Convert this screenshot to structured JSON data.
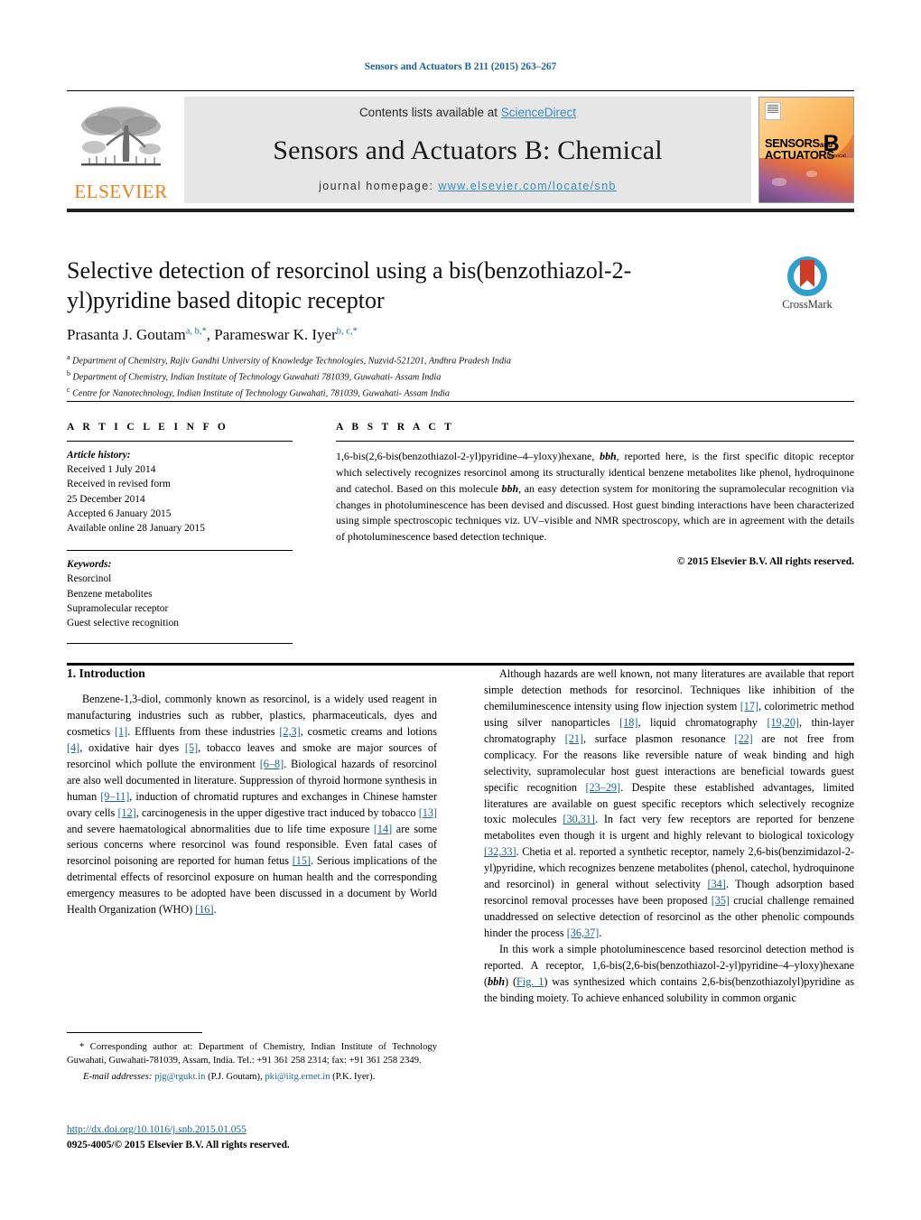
{
  "running_head": "Sensors and Actuators B 211 (2015) 263–267",
  "masthead": {
    "contents_prefix": "Contents lists available at ",
    "sciencedirect": "ScienceDirect",
    "journal_title": "Sensors and Actuators B: Chemical",
    "homepage_prefix": "journal homepage:",
    "homepage_url": "www.elsevier.com/locate/snb",
    "publisher_logo_text": "ELSEVIER",
    "cover": {
      "line1": "SENSORS",
      "line1_small": "and",
      "line2": "ACTUATORS",
      "volume_letter": "B",
      "volume_sub": "Chemical"
    }
  },
  "crossmark": {
    "label": "CrossMark"
  },
  "article": {
    "title": "Selective detection of resorcinol using a bis(benzothiazol-2-yl)pyridine based ditopic receptor",
    "authors": [
      {
        "name": "Prasanta J. Goutam",
        "sup": "a, b,",
        "star": "*"
      },
      {
        "name": "Parameswar K. Iyer",
        "sup": "b, c,",
        "star": "*"
      }
    ],
    "authors_separator": ", ",
    "affiliations": [
      {
        "marker": "a",
        "text": "Department of Chemistry, Rajiv Gandhi University of Knowledge Technologies, Nuzvid-521201, Andhra Pradesh India"
      },
      {
        "marker": "b",
        "text": "Department of Chemistry, Indian Institute of Technology Guwahati 781039, Guwahati- Assam India"
      },
      {
        "marker": "c",
        "text": "Centre for Nanotechnology, Indian Institute of Technology Guwahati, 781039, Guwahati- Assam India"
      }
    ]
  },
  "article_info": {
    "heading": "A R T I C L E   I N F O",
    "history_label": "Article history:",
    "history": [
      "Received 1 July 2014",
      "Received in revised form",
      "25 December 2014",
      "Accepted 6 January 2015",
      "Available online 28 January 2015"
    ],
    "keywords_label": "Keywords:",
    "keywords": [
      "Resorcinol",
      "Benzene metabolites",
      "Supramolecular receptor",
      "Guest selective recognition"
    ]
  },
  "abstract": {
    "heading": "A B S T R A C T",
    "part1": "1,6-bis(2,6-bis(benzothiazol-2-yl)pyridine–4–yloxy)hexane, ",
    "bbh1": "bbh",
    "part2": ", reported here, is the first specific ditopic receptor which selectively recognizes resorcinol among its structurally identical benzene metabolites like phenol, hydroquinone and catechol. Based on this molecule ",
    "bbh2": "bbh",
    "part3": ", an easy detection system for monitoring the supramolecular recognition via changes in photoluminescence has been devised and discussed. Host guest binding interactions have been characterized using simple spectroscopic techniques viz. UV–visible and NMR spectroscopy, which are in agreement with the details of photoluminescence based detection technique.",
    "copyright": "© 2015 Elsevier B.V. All rights reserved."
  },
  "sections": {
    "intro_heading": "1.  Introduction",
    "left_para_1": {
      "t1": "Benzene-1,3-diol, commonly known as resorcinol, is a widely used reagent in manufacturing industries such as rubber, plastics, pharmaceuticals, dyes and cosmetics ",
      "r1": "[1]",
      "t2": ". Effluents from these industries ",
      "r2": "[2,3]",
      "t3": ", cosmetic creams and lotions ",
      "r3": "[4]",
      "t4": ", oxidative hair dyes ",
      "r4": "[5]",
      "t5": ", tobacco leaves and smoke are major sources of resorcinol which pollute the environment ",
      "r5": "[6–8]",
      "t6": ". Biological hazards of resorcinol are also well documented in literature. Suppression of thyroid hormone synthesis in human ",
      "r6": "[9–11]",
      "t7": ", induction of chromatid ruptures and exchanges in Chinese hamster ovary cells ",
      "r7": "[12]",
      "t8": ", carcinogenesis in the upper digestive tract induced by tobacco ",
      "r8": "[13]",
      "t9": " and severe haematological abnormalities due to life time exposure ",
      "r9": "[14]",
      "t10": " are some serious concerns where resorcinol was found responsible. Even fatal cases of resorcinol poisoning are reported for human fetus ",
      "r10": "[15]",
      "t11": ". Serious implications of the detrimental effects of resorcinol exposure on human health and the corresponding emergency measures to be adopted have been discussed in a document by World Health Organization (WHO) ",
      "r11": "[16]",
      "t12": "."
    },
    "right_para_1": {
      "t1": "Although hazards are well known, not many literatures are available that report simple detection methods for resorcinol. Techniques like inhibition of the chemiluminescence intensity using flow injection system ",
      "r1": "[17]",
      "t2": ", colorimetric method using silver nanoparticles ",
      "r2": "[18]",
      "t3": ", liquid chromatography ",
      "r3": "[19,20]",
      "t4": ", thin-layer chromatography ",
      "r4": "[21]",
      "t5": ", surface plasmon resonance ",
      "r5": "[22]",
      "t6": " are not free from complicacy. For the reasons like reversible nature of weak binding and high selectivity, supramolecular host guest interactions are beneficial towards guest specific recognition ",
      "r6": "[23–29]",
      "t7": ". Despite these established advantages, limited literatures are available on guest specific receptors which selectively recognize toxic molecules ",
      "r7": "[30,31]",
      "t8": ". In fact very few receptors are reported for benzene metabolites even though it is urgent and highly relevant to biological toxicology ",
      "r8": "[32,33]",
      "t9": ". Chetia et al. reported a synthetic receptor, namely 2,6-bis(benzimidazol-2-yl)pyridine, which recognizes benzene metabolites (phenol, catechol, hydroquinone and resorcinol) in general without selectivity ",
      "r9": "[34]",
      "t10": ". Though adsorption based resorcinol removal processes have been proposed ",
      "r10": "[35]",
      "t11": " crucial challenge remained unaddressed on selective detection of resorcinol as the other phenolic compounds hinder the process ",
      "r11": "[36,37]",
      "t12": "."
    },
    "right_para_2": {
      "t1": "In this work a simple photoluminescence based resorcinol detection method is reported. A receptor, 1,6-bis(2,6-bis(benzothiazol-2-yl)pyridine–4–yloxy)hexane (",
      "bbh": "bbh",
      "t2": ") (",
      "fig": "Fig. 1",
      "t3": ") was synthesized which contains 2,6-bis(benzothiazolyl)pyridine as the binding moiety. To achieve enhanced solubility in common organic"
    }
  },
  "footnotes": {
    "corresponding_marker": "*",
    "corresponding_text": " Corresponding author at: Department of Chemistry, Indian Institute of Technology Guwahati, Guwahati-781039, Assam, India. Tel.: +91 361 258 2314; fax: +91 361 258 2349.",
    "email_label": "E-mail addresses:",
    "emails": [
      {
        "address": "pjg@rgukt.in",
        "owner": "(P.J. Goutam)"
      },
      {
        "address": "pki@iitg.ernet.in",
        "owner": "(P.K. Iyer)"
      }
    ],
    "email_separator": ", "
  },
  "footer": {
    "doi": "http://dx.doi.org/10.1016/j.snb.2015.01.055",
    "issn_line": "0925-4005/© 2015 Elsevier B.V. All rights reserved."
  },
  "colors": {
    "link_blue": "#1a6496",
    "sciencedirect_blue": "#3a8cc1",
    "elsevier_orange": "#f07f1a",
    "crossmark_blue": "#2f9fd0",
    "crossmark_red": "#cf3b27",
    "masthead_grey": "#e6e6e6"
  }
}
